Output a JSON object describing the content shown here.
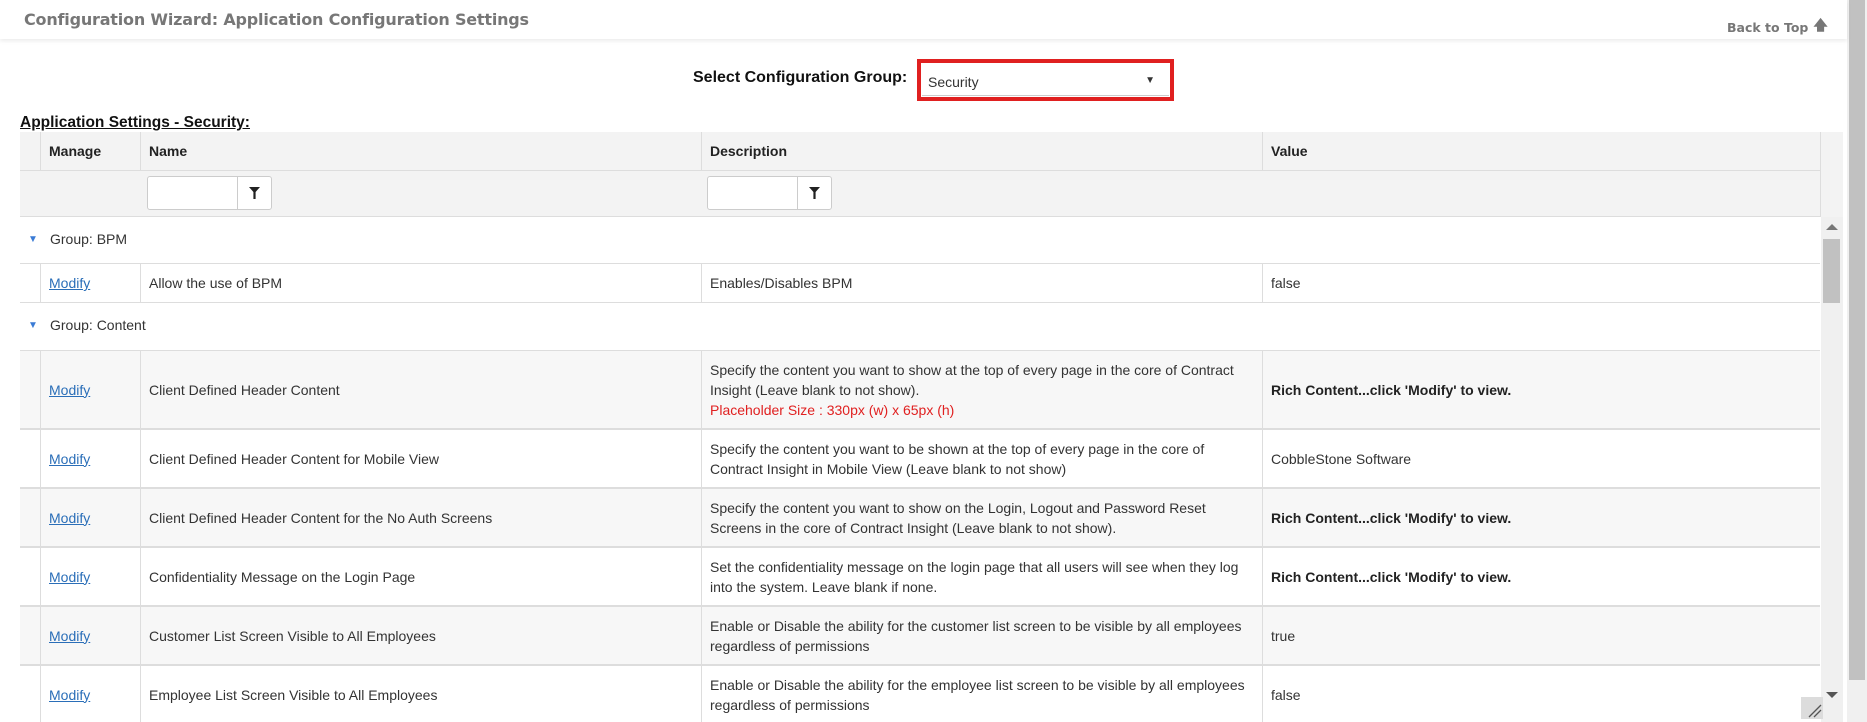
{
  "header": {
    "title": "Configuration Wizard: Application Configuration Settings",
    "back_to_top": "Back to Top",
    "back_to_top_icon": "arrow-up-icon"
  },
  "group_selector": {
    "label": "Select Configuration Group:",
    "selected": "Security",
    "highlight_color": "#e02020"
  },
  "section_title": "Application Settings - Security:",
  "grid": {
    "columns": [
      "Manage",
      "Name",
      "Description",
      "Value"
    ],
    "filters": {
      "name": {
        "value": "",
        "icon": "filter-icon"
      },
      "description": {
        "value": "",
        "icon": "filter-icon"
      }
    },
    "groups": [
      {
        "label": "Group: BPM",
        "rows": [
          {
            "manage": "Modify",
            "name": "Allow the use of BPM",
            "description": "Enables/Disables BPM",
            "note": "",
            "value": "false",
            "value_bold": false
          }
        ]
      },
      {
        "label": "Group: Content",
        "rows": [
          {
            "manage": "Modify",
            "name": "Client Defined Header Content",
            "description": "Specify the content you want to show at the top of every page in the core of Contract Insight (Leave blank to not show).",
            "note": "Placeholder Size : 330px (w) x 65px (h)",
            "value": "Rich Content...click 'Modify' to view.",
            "value_bold": true
          },
          {
            "manage": "Modify",
            "name": "Client Defined Header Content for Mobile View",
            "description": "Specify the content you want to be shown at the top of every page in the core of Contract Insight in Mobile View (Leave blank to not show)",
            "note": "",
            "value": "CobbleStone Software",
            "value_bold": false
          },
          {
            "manage": "Modify",
            "name": "Client Defined Header Content for the No Auth Screens",
            "description": "Specify the content you want to show on the Login, Logout and Password Reset Screens in the core of Contract Insight (Leave blank to not show).",
            "note": "",
            "value": "Rich Content...click 'Modify' to view.",
            "value_bold": true
          },
          {
            "manage": "Modify",
            "name": "Confidentiality Message on the Login Page",
            "description": "Set the confidentiality message on the login page that all users will see when they log into the system. Leave blank if none.",
            "note": "",
            "value": "Rich Content...click 'Modify' to view.",
            "value_bold": true
          },
          {
            "manage": "Modify",
            "name": "Customer List Screen Visible to All Employees",
            "description": "Enable or Disable the ability for the customer list screen to be visible by all employees regardless of permissions",
            "note": "",
            "value": "true",
            "value_bold": false
          },
          {
            "manage": "Modify",
            "name": "Employee List Screen Visible to All Employees",
            "description": "Enable or Disable the ability for the employee list screen to be visible by all employees regardless of permissions",
            "note": "",
            "value": "false",
            "value_bold": false
          }
        ]
      }
    ]
  }
}
